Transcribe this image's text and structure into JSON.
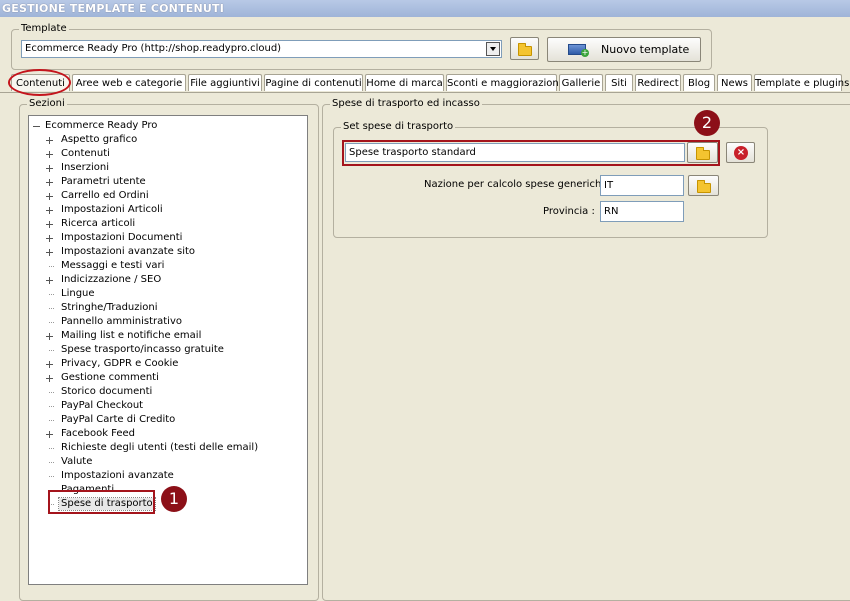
{
  "window": {
    "title": "GESTIONE TEMPLATE E CONTENUTI"
  },
  "template_group": {
    "label": "Template",
    "combo_value": "Ecommerce Ready Pro (http://shop.readypro.cloud)",
    "new_button_label": "Nuovo template"
  },
  "tabs": [
    {
      "label": "Contenuti",
      "active": true
    },
    {
      "label": "Aree web e categorie"
    },
    {
      "label": "File aggiuntivi"
    },
    {
      "label": "Pagine di contenuti"
    },
    {
      "label": "Home di marca"
    },
    {
      "label": "Sconti e maggiorazioni"
    },
    {
      "label": "Gallerie"
    },
    {
      "label": "Siti"
    },
    {
      "label": "Redirect"
    },
    {
      "label": "Blog"
    },
    {
      "label": "News"
    },
    {
      "label": "Template e plugins"
    }
  ],
  "sections": {
    "label": "Sezioni",
    "root": "Ecommerce Ready Pro",
    "items": [
      {
        "label": "Aspetto grafico",
        "expandable": true
      },
      {
        "label": "Contenuti",
        "expandable": true
      },
      {
        "label": "Inserzioni",
        "expandable": true
      },
      {
        "label": "Parametri utente",
        "expandable": true
      },
      {
        "label": "Carrello ed Ordini",
        "expandable": true
      },
      {
        "label": "Impostazioni Articoli",
        "expandable": true
      },
      {
        "label": "Ricerca articoli",
        "expandable": true
      },
      {
        "label": "Impostazioni Documenti",
        "expandable": true
      },
      {
        "label": "Impostazioni avanzate sito",
        "expandable": true
      },
      {
        "label": "Messaggi e testi vari",
        "expandable": false
      },
      {
        "label": "Indicizzazione / SEO",
        "expandable": true
      },
      {
        "label": "Lingue",
        "expandable": false
      },
      {
        "label": "Stringhe/Traduzioni",
        "expandable": false
      },
      {
        "label": "Pannello amministrativo",
        "expandable": false
      },
      {
        "label": "Mailing list e notifiche email",
        "expandable": true
      },
      {
        "label": "Spese trasporto/incasso gratuite",
        "expandable": false
      },
      {
        "label": "Privacy, GDPR e Cookie",
        "expandable": true
      },
      {
        "label": "Gestione commenti",
        "expandable": true
      },
      {
        "label": "Storico documenti",
        "expandable": false
      },
      {
        "label": "PayPal Checkout",
        "expandable": false
      },
      {
        "label": "PayPal Carte di Credito",
        "expandable": false
      },
      {
        "label": "Facebook Feed",
        "expandable": true
      },
      {
        "label": "Richieste degli utenti (testi delle email)",
        "expandable": false
      },
      {
        "label": "Valute",
        "expandable": false
      },
      {
        "label": "Impostazioni avanzate",
        "expandable": false
      },
      {
        "label": "Pagamenti",
        "expandable": false
      },
      {
        "label": "Spese di trasporto",
        "expandable": false,
        "selected": true
      }
    ]
  },
  "shipping": {
    "group_label": "Spese di trasporto ed incasso",
    "set_label": "Set spese di trasporto",
    "set_value": "Spese trasporto standard",
    "nation_label": "Nazione per calcolo spese generiche :",
    "nation_value": "IT",
    "province_label": "Provincia :",
    "province_value": "RN"
  },
  "annotations": {
    "badge1": "1",
    "badge2": "2"
  },
  "colors": {
    "annotation_red": "#a4141c",
    "badge": "#8c1018"
  }
}
